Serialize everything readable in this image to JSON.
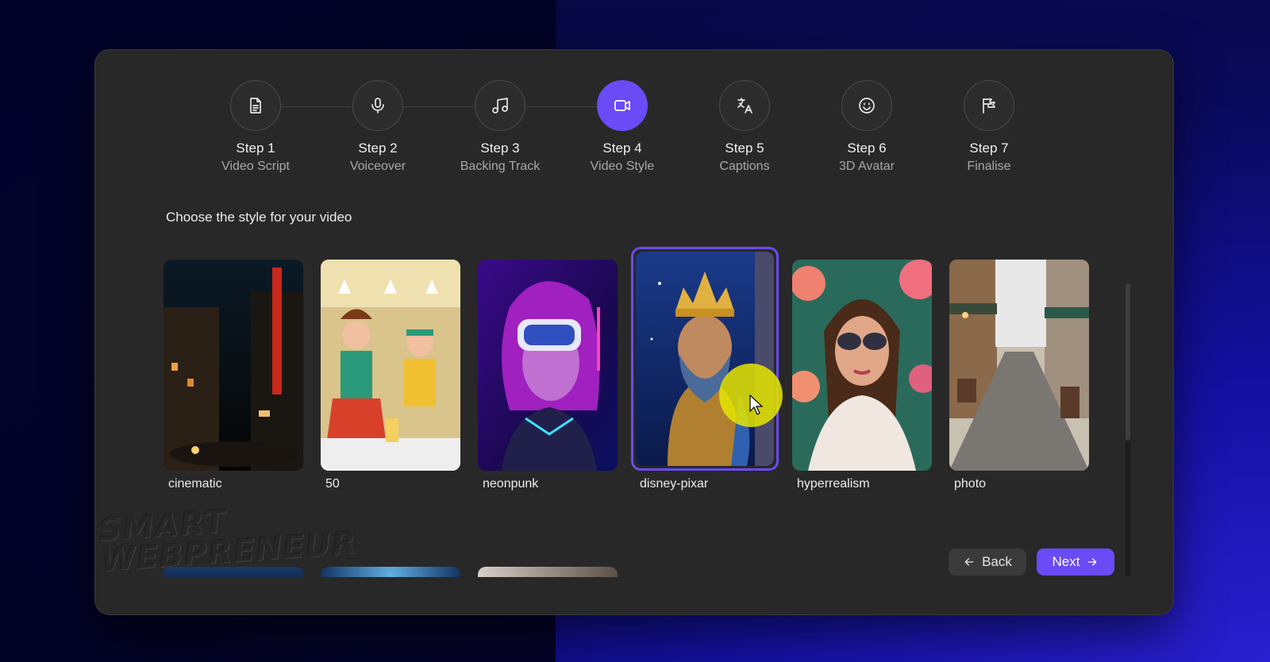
{
  "steps": [
    {
      "number": "Step 1",
      "name": "Video Script",
      "icon": "document-icon",
      "active": false
    },
    {
      "number": "Step 2",
      "name": "Voiceover",
      "icon": "microphone-icon",
      "active": false
    },
    {
      "number": "Step 3",
      "name": "Backing Track",
      "icon": "music-note-icon",
      "active": false
    },
    {
      "number": "Step 4",
      "name": "Video Style",
      "icon": "video-camera-icon",
      "active": true
    },
    {
      "number": "Step 5",
      "name": "Captions",
      "icon": "translate-icon",
      "active": false
    },
    {
      "number": "Step 6",
      "name": "3D Avatar",
      "icon": "smile-icon",
      "active": false
    },
    {
      "number": "Step 7",
      "name": "Finalise",
      "icon": "flag-icon",
      "active": false
    }
  ],
  "prompt": "Choose the style for your video",
  "styles": [
    {
      "label": "cinematic",
      "selected": false
    },
    {
      "label": "50",
      "selected": false
    },
    {
      "label": "neonpunk",
      "selected": false
    },
    {
      "label": "disney-pixar",
      "selected": true
    },
    {
      "label": "hyperrealism",
      "selected": false
    },
    {
      "label": "photo",
      "selected": false
    }
  ],
  "buttons": {
    "back": "Back",
    "next": "Next"
  },
  "watermark": {
    "line1": "SMART",
    "line2": "WEBPRENEUR"
  },
  "colors": {
    "accent": "#6a4bf5",
    "dialog": "#282828"
  }
}
